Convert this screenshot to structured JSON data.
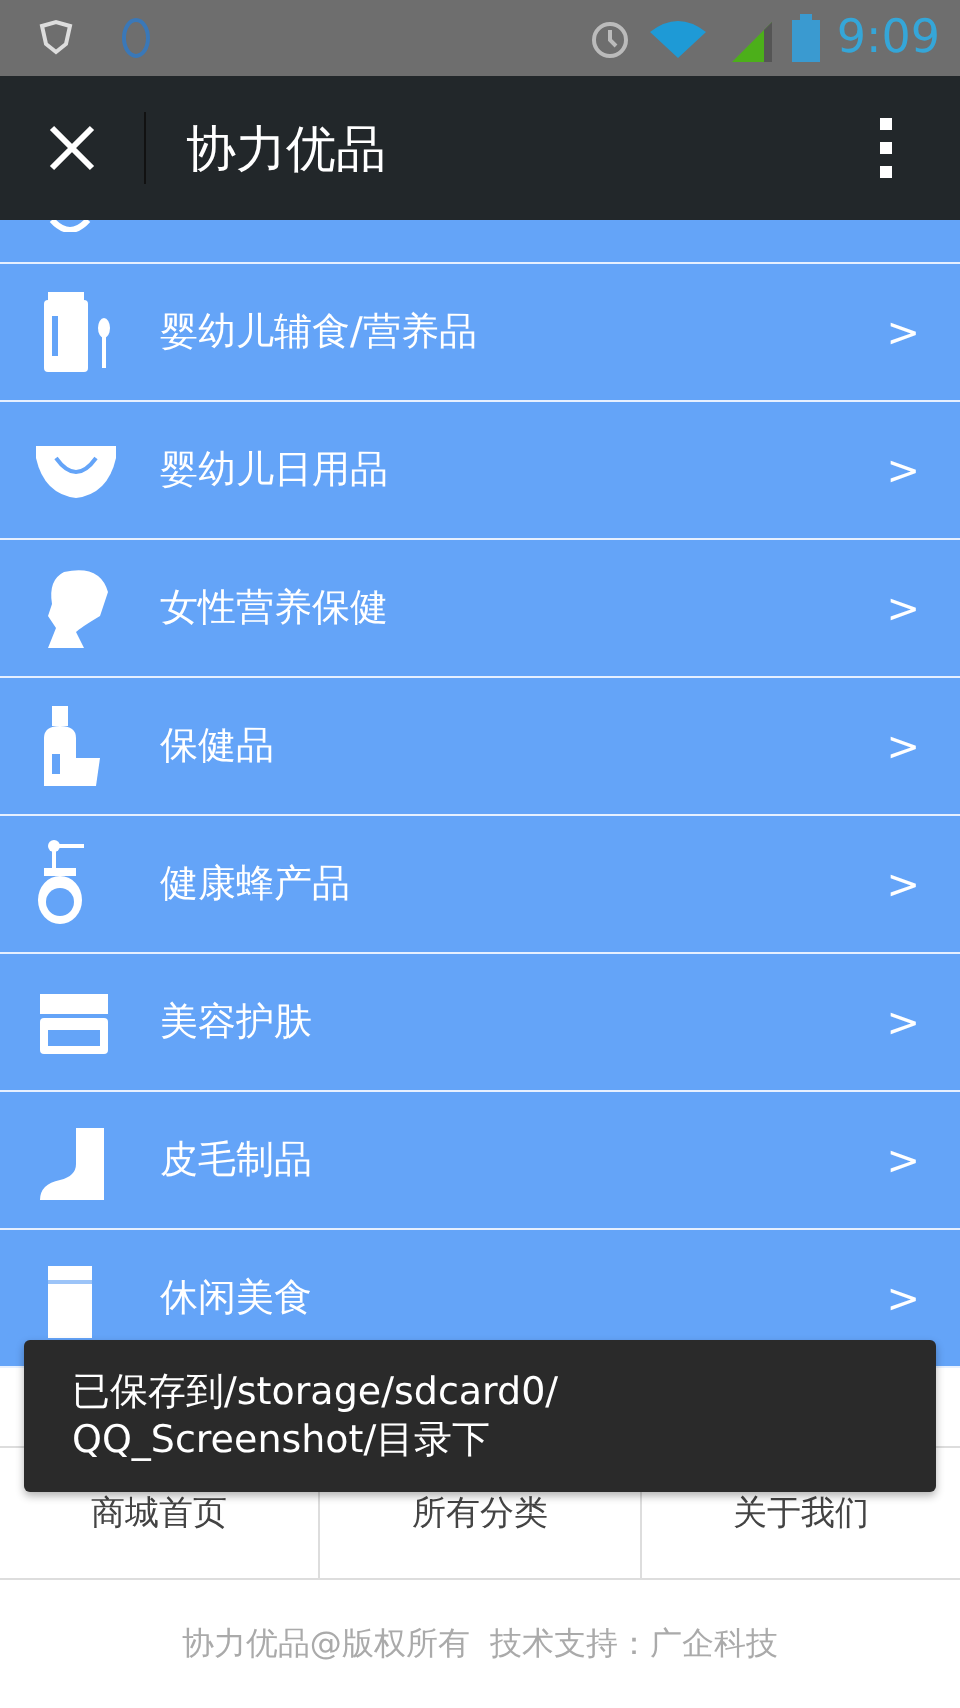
{
  "status_bar": {
    "time": "9:09"
  },
  "app_bar": {
    "title": "协力优品"
  },
  "categories": [
    {
      "label": "婴幼儿辅食/营养品",
      "chevron": ">"
    },
    {
      "label": "婴幼儿日用品",
      "chevron": ">"
    },
    {
      "label": "女性营养保健",
      "chevron": ">"
    },
    {
      "label": "保健品",
      "chevron": ">"
    },
    {
      "label": "健康蜂产品",
      "chevron": ">"
    },
    {
      "label": "美容护肤",
      "chevron": ">"
    },
    {
      "label": "皮毛制品",
      "chevron": ">"
    },
    {
      "label": "休闲美食",
      "chevron": ">"
    }
  ],
  "bottom_nav": [
    {
      "label": "商城首页"
    },
    {
      "label": "所有分类"
    },
    {
      "label": "关于我们"
    }
  ],
  "footer": {
    "text": "协力优品@版权所有  技术支持：广企科技"
  },
  "toast": {
    "text": "已保存到/storage/sdcard0/\nQQ_Screenshot/目录下"
  }
}
